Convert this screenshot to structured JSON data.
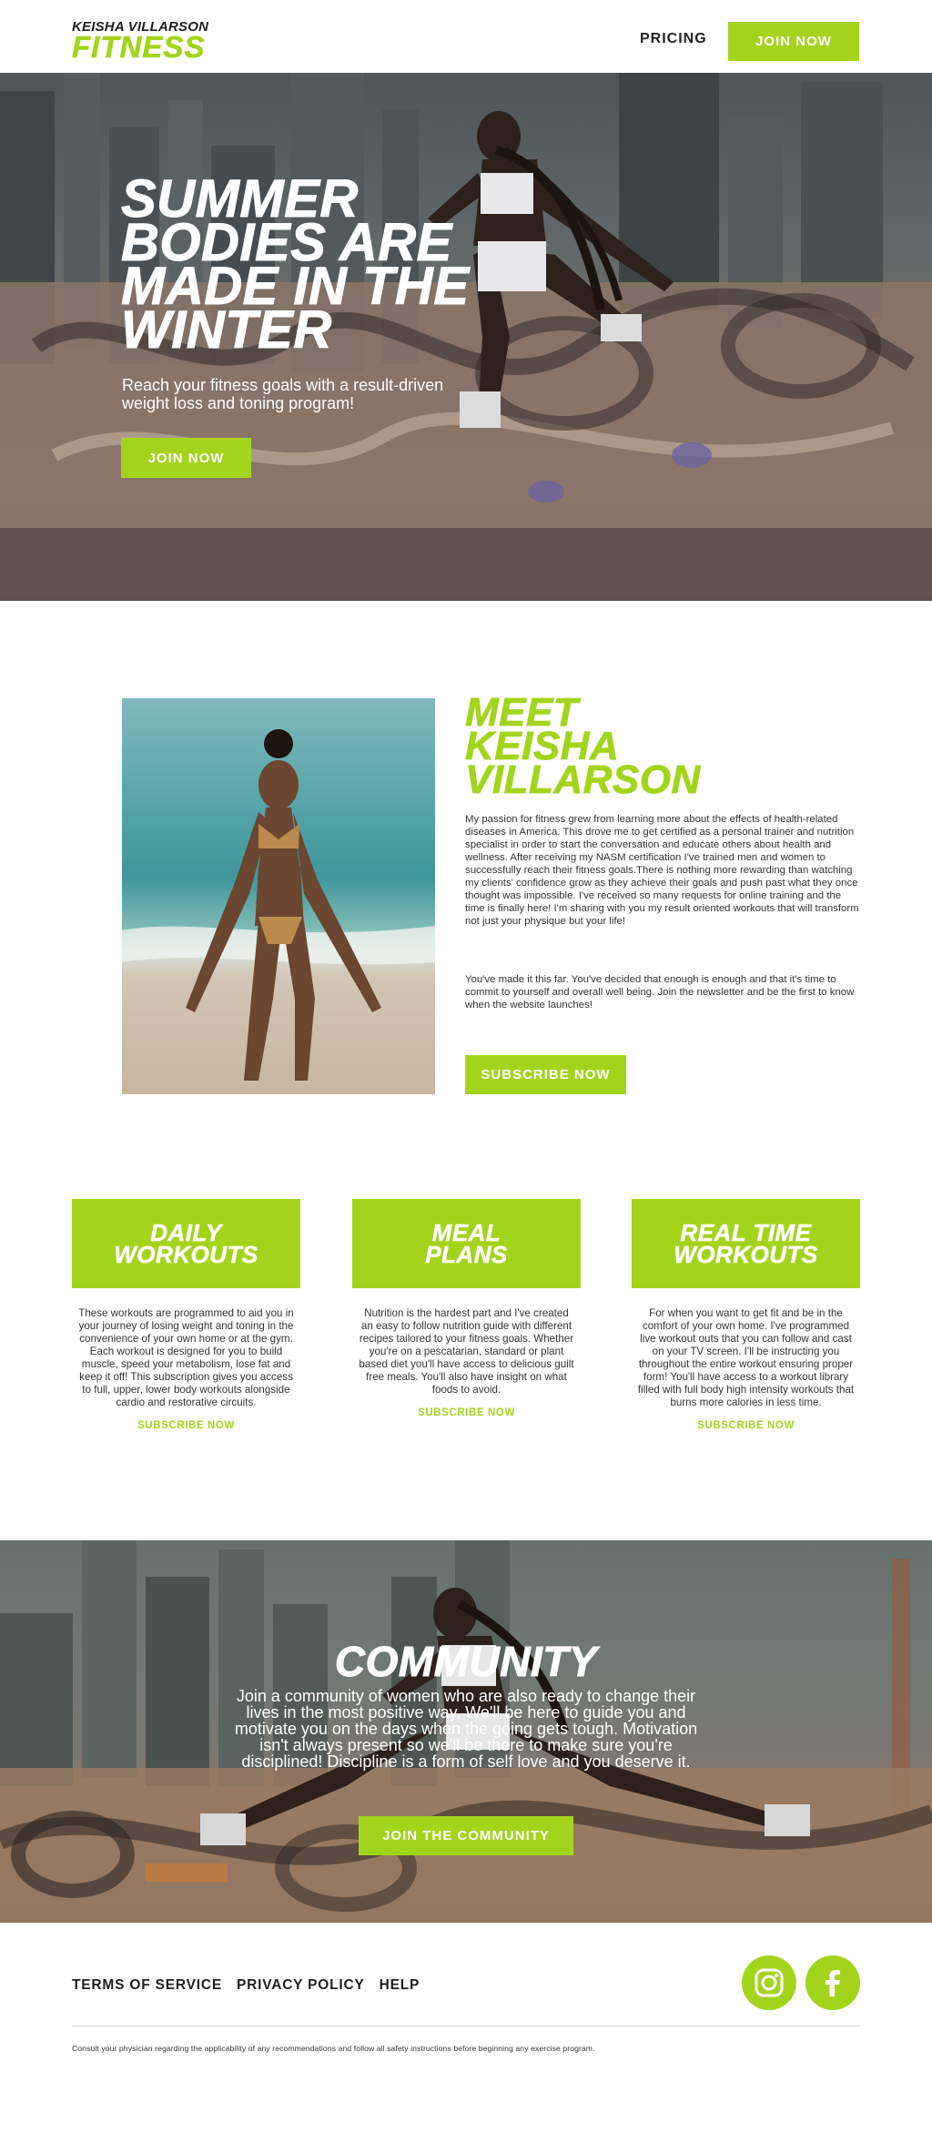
{
  "brand": {
    "name_top": "KEISHA VILLARSON",
    "name_bottom": "FITNESS",
    "accent_color": "#a3d41c"
  },
  "nav": {
    "pricing": "PRICING",
    "join": "JOIN NOW"
  },
  "hero": {
    "headline": "SUMMER BODIES ARE MADE IN THE WINTER",
    "subtext": "Reach your fitness goals with a result-driven weight loss and toning program!",
    "cta": "JOIN NOW"
  },
  "meet": {
    "title": "MEET KEISHA VILLARSON",
    "paragraph1": "My passion for fitness grew from learning more about the effects of health-related diseases in America. This drove me to get certified as a personal trainer and nutrition specialist in order to start the conversation and educate others about health and wellness. After receiving my NASM certification I've trained men and women to successfully reach their fitness goals.There is nothing more rewarding than watching my clients' confidence grow as they achieve their goals and push past what they once thought was impossible. I've received so many requests for online training and the time is finally here! I'm sharing with you my result oriented workouts that will transform not just your physique but your life!",
    "paragraph2": "You've made it this far. You've decided that enough is enough and that it's time to commit to yourself and overall well being. Join the newsletter and be the first to know when the website launches!",
    "cta": "SUBSCRIBE NOW"
  },
  "features": [
    {
      "title": "DAILY WORKOUTS",
      "text": "These workouts are programmed to aid you in your journey of losing weight and toning in the convenience of your own home or at the gym. Each workout is designed for you to build muscle, speed your metabolism, lose fat and keep it off! This subscription gives you access to full, upper, lower body workouts alongside cardio and restorative circuits.",
      "link": "SUBSCRIBE NOW"
    },
    {
      "title": "MEAL PLANS",
      "text": "Nutrition is the hardest part and I've created an easy to follow nutrition guide with different recipes tailored to your fitness goals. Whether you're on a pescatarian, standard or plant based diet you'll have access to delicious guilt free meals. You'll also have insight on what foods to avoid.",
      "link": "SUBSCRIBE NOW"
    },
    {
      "title": "REAL TIME WORKOUTS",
      "text": "For when you want to get fit and be in the comfort of your own home. I've programmed live workout outs that you can follow and cast on your TV screen. I'll be instructing you throughout the entire workout ensuring proper form! You'll have access to a workout library filled with full body high intensity workouts that burns more calories in less time.",
      "link": "SUBSCRIBE NOW"
    }
  ],
  "community": {
    "title": "COMMUNITY",
    "text": "Join a community of women who are also ready to change their lives in the most positive way. We'll be here to guide you and motivate you on the days when the going gets tough. Motivation isn't always present so we'll be there to make sure you're disciplined! Discipline is a form of self love and you deserve it.",
    "cta": "JOIN THE COMMUNITY"
  },
  "footer": {
    "links": [
      "TERMS OF SERVICE",
      "PRIVACY POLICY",
      "HELP"
    ],
    "social_icons": [
      "instagram-icon",
      "facebook-icon"
    ],
    "disclaimer": "Consult your physician regarding the applicability of any recommendations and follow all safety instructions before beginning any exercise program."
  }
}
